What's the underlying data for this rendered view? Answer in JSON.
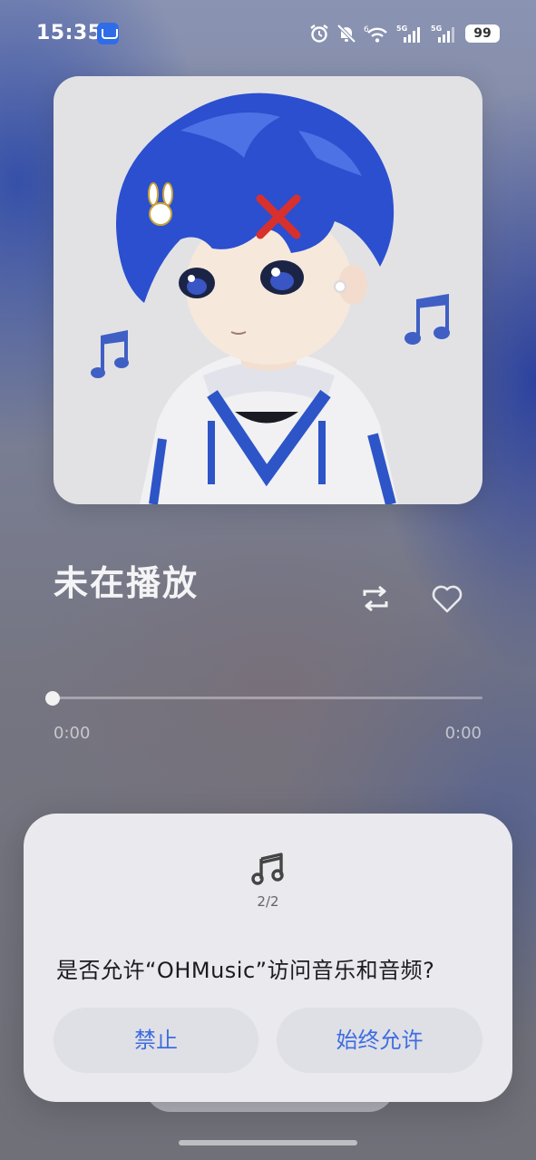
{
  "status_bar": {
    "time": "15:35",
    "app_badge_icon": "app-market-icon",
    "network_label_1": "5G",
    "network_label_2": "5G",
    "wifi_label": "6",
    "battery": "99"
  },
  "player": {
    "title": "未在播放",
    "current_time": "0:00",
    "total_time": "0:00",
    "progress": 0,
    "repeat_icon": "repeat-icon",
    "like_icon": "heart-icon"
  },
  "dialog": {
    "icon": "music-note-icon",
    "counter": "2/2",
    "message": "是否允许“OHMusic”访问音乐和音频?",
    "deny_label": "禁止",
    "allow_label": "始终允许",
    "accent_color": "#3e6ce0"
  }
}
